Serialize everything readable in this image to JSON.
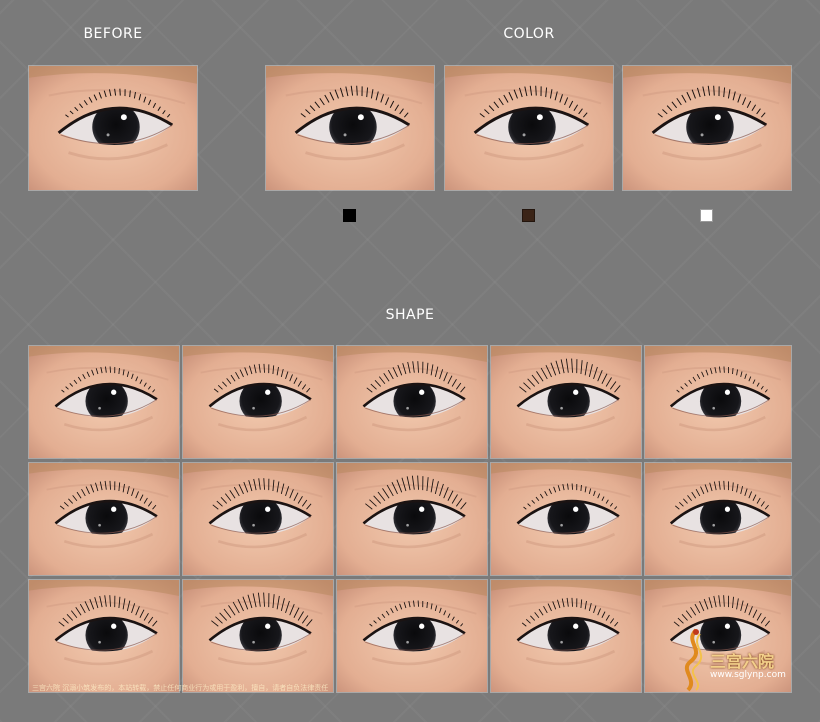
{
  "labels": {
    "before": "BEFORE",
    "color": "COLOR",
    "shape": "SHAPE"
  },
  "color_swatches": [
    {
      "name": "black",
      "hex": "#000000"
    },
    {
      "name": "brown",
      "hex": "#3b2417"
    },
    {
      "name": "white",
      "hex": "#ffffff"
    }
  ],
  "shape_grid": {
    "rows": 3,
    "columns": 5
  },
  "watermark": {
    "text": "三宫六院 沉溺小筑发布的，本站转载，禁止任何商业行为或用于盈利，擅自，请者自负法律责任",
    "logo_text": "三宫六院",
    "logo_url": "www.sglynp.com"
  }
}
